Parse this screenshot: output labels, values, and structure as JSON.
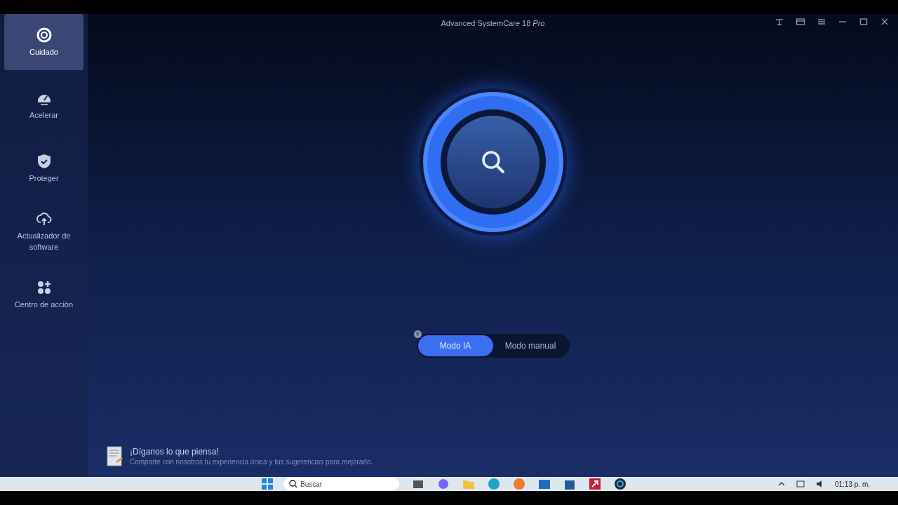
{
  "window": {
    "title": "Advanced SystemCare 18",
    "edition": "Pro"
  },
  "sidebar": {
    "items": [
      {
        "label": "Cuidado",
        "selected": true
      },
      {
        "label": "Acelerar",
        "selected": false
      },
      {
        "label": "Proteger",
        "selected": false
      },
      {
        "label": "Actualizador de software",
        "selected": false
      },
      {
        "label": "Centro de acción",
        "selected": false
      }
    ]
  },
  "mode_toggle": {
    "help": "?",
    "options": [
      {
        "label": "Modo IA",
        "selected": true
      },
      {
        "label": "Modo manual",
        "selected": false
      }
    ]
  },
  "feedback": {
    "title": "¡Díganos lo que piensa!",
    "text": "Comparte con nosotros tu experiencia única y tus sugerencias para mejorarlo."
  },
  "taskbar": {
    "search_placeholder": "Buscar",
    "time": "01:13 p. m."
  }
}
